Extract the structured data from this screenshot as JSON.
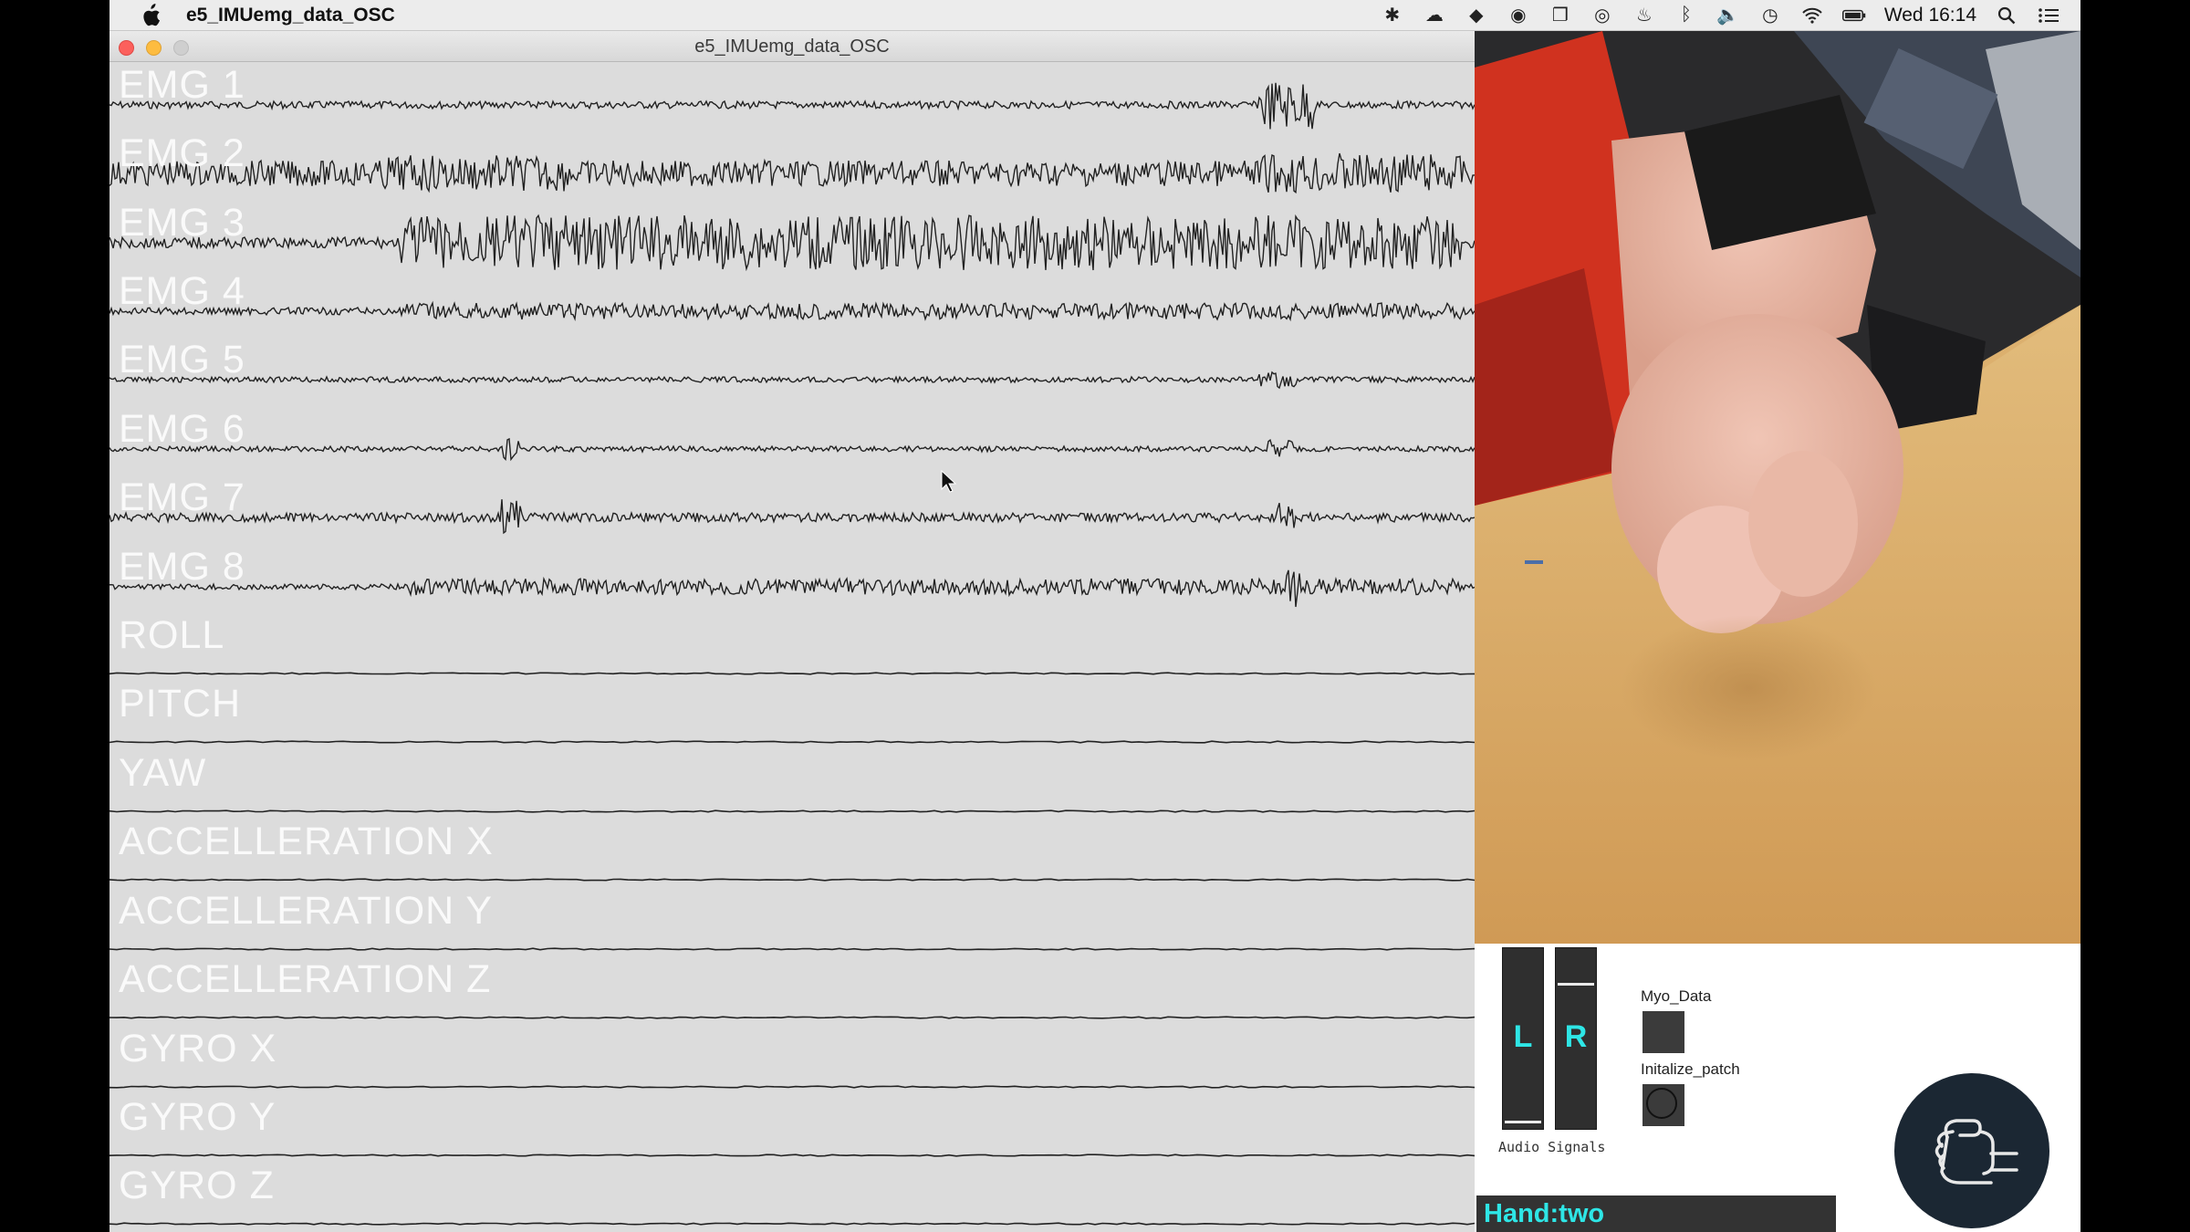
{
  "menubar": {
    "app_name": "e5_IMUemg_data_OSC",
    "clock": "Wed 16:14",
    "status_icons": [
      "asterisk-icon",
      "creative-cloud-icon",
      "dropbox-icon",
      "record-icon",
      "layers-icon",
      "sync-icon",
      "flame-icon",
      "bluetooth-icon",
      "volume-icon",
      "time-machine-icon",
      "wifi-icon",
      "battery-icon",
      "spotlight-icon",
      "notification-center-icon"
    ]
  },
  "window": {
    "title": "e5_IMUemg_data_OSC"
  },
  "channels": [
    {
      "label": "EMG 1",
      "kind": "emg"
    },
    {
      "label": "EMG 2",
      "kind": "emg"
    },
    {
      "label": "EMG 3",
      "kind": "emg"
    },
    {
      "label": "EMG 4",
      "kind": "emg"
    },
    {
      "label": "EMG 5",
      "kind": "emg"
    },
    {
      "label": "EMG 6",
      "kind": "emg"
    },
    {
      "label": "EMG 7",
      "kind": "emg"
    },
    {
      "label": "EMG 8",
      "kind": "emg"
    },
    {
      "label": "ROLL",
      "kind": "imu"
    },
    {
      "label": "PITCH",
      "kind": "imu"
    },
    {
      "label": "YAW",
      "kind": "imu"
    },
    {
      "label": "ACCELLERATION X",
      "kind": "imu"
    },
    {
      "label": "ACCELLERATION Y",
      "kind": "imu"
    },
    {
      "label": "ACCELLERATION Z",
      "kind": "imu"
    },
    {
      "label": "GYRO X",
      "kind": "imu"
    },
    {
      "label": "GYRO Y",
      "kind": "imu"
    },
    {
      "label": "GYRO Z",
      "kind": "imu"
    }
  ],
  "panel": {
    "meter_left_letter": "L",
    "meter_right_letter": "R",
    "audio_label": "Audio Signals",
    "myo_label": "Myo_Data",
    "init_label": "Initalize_patch",
    "hand_status": "Hand:two"
  },
  "colors": {
    "accent": "#2ee6e6",
    "plot_bg": "#dcdcdc",
    "trace": "#222222"
  }
}
